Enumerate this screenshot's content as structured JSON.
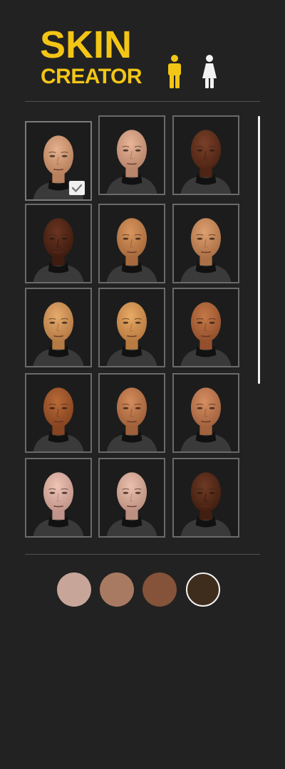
{
  "header": {
    "title_line1": "SKIN",
    "title_line2": "CREATOR",
    "gender_buttons": [
      {
        "id": "male",
        "icon": "male-figure-icon",
        "color": "#f3c515",
        "active": true
      },
      {
        "id": "female",
        "icon": "female-figure-icon",
        "color": "#f2f2f2",
        "active": false
      }
    ]
  },
  "faces": [
    {
      "skin": "#e4b08e",
      "shade": "#b8805c",
      "selected": true
    },
    {
      "skin": "#e8b598",
      "shade": "#b8846a",
      "selected": false
    },
    {
      "skin": "#7a4028",
      "shade": "#4e2414",
      "selected": false
    },
    {
      "skin": "#6a3420",
      "shade": "#3e1c10",
      "selected": false
    },
    {
      "skin": "#d8965e",
      "shade": "#a86a3c",
      "selected": false
    },
    {
      "skin": "#dea070",
      "shade": "#ac7046",
      "selected": false
    },
    {
      "skin": "#e6aa6c",
      "shade": "#b47a44",
      "selected": false
    },
    {
      "skin": "#e8aa66",
      "shade": "#b87a40",
      "selected": false
    },
    {
      "skin": "#c47848",
      "shade": "#94502c",
      "selected": false
    },
    {
      "skin": "#b86a38",
      "shade": "#864420",
      "selected": false
    },
    {
      "skin": "#d48c5c",
      "shade": "#a0603a",
      "selected": false
    },
    {
      "skin": "#d68e62",
      "shade": "#a2623e",
      "selected": false
    },
    {
      "skin": "#eec4b4",
      "shade": "#c0948a",
      "selected": false
    },
    {
      "skin": "#ecc0ae",
      "shade": "#bc9080",
      "selected": false
    },
    {
      "skin": "#6e3a24",
      "shade": "#421e10",
      "selected": false
    }
  ],
  "skin_tones": [
    {
      "color": "#c7a699",
      "selected": false
    },
    {
      "color": "#a97a62",
      "selected": false
    },
    {
      "color": "#84533a",
      "selected": false
    },
    {
      "color": "#3e2c1c",
      "selected": true
    }
  ],
  "icons": {
    "selected_check": "checkmark-icon"
  }
}
